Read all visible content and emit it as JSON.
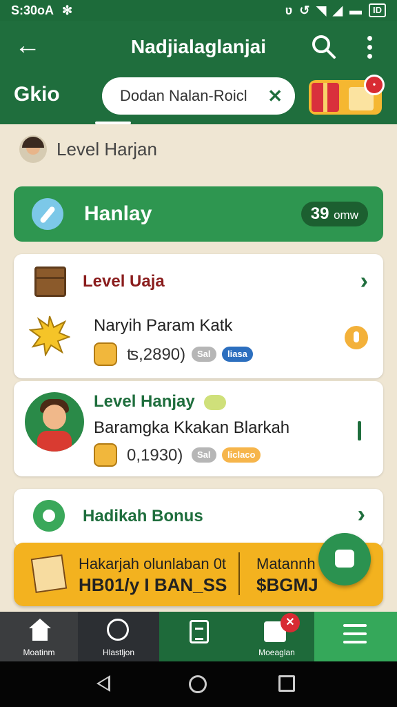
{
  "status_bar": {
    "time": "S:30oA",
    "bluetooth": "✻",
    "battery": "ID"
  },
  "app_bar": {
    "title": "Nadjialaglanjai",
    "tab_label": "Gkio",
    "search_value": "Dodan Nalan-Roicl",
    "clear_symbol": "✕",
    "gift_badge": "•"
  },
  "level_header": {
    "label": "Level Harjan"
  },
  "green_card": {
    "label": "Hanlay",
    "value": "39",
    "unit": "omw"
  },
  "card1": {
    "title": "Level Uaja",
    "subtitle": "Naryih Param Katk",
    "amount": "ʦ,2890)",
    "tag1": "Sal",
    "tag2": "liasa"
  },
  "card2": {
    "title": "Level Hanjay",
    "subtitle": "Baramgka Kkakan Blarkah",
    "amount": "0,1930)",
    "tag1": "Sal",
    "tag2": "liclaco"
  },
  "card3": {
    "title": "Hadikah Bonus"
  },
  "banner": {
    "left_line1": "Hakarjah olunlaban 0t",
    "left_line2": "HB01/y I BAN_SS",
    "right_line1": "Matannh",
    "right_line2": "$BGMJ"
  },
  "bottom_nav": {
    "home": "Moatinm",
    "search": "Hlastljon",
    "messages": "Moeaglan",
    "messages_badge": "✕"
  },
  "colors": {
    "primary_green": "#1f6e3d",
    "accent_green": "#2e9650",
    "banner_yellow": "#f3b21f",
    "badge_red": "#d82b33"
  },
  "icons": [
    "back-arrow-icon",
    "search-icon",
    "more-vert-icon",
    "gift-icon",
    "avatar-icon",
    "feather-icon",
    "box-icon",
    "sun-burst-icon",
    "coin-icon",
    "lock-icon",
    "kid-avatar-icon",
    "bonus-icon",
    "chat-fab-icon",
    "home-icon",
    "search-nav-icon",
    "clipboard-icon",
    "message-icon",
    "menu-icon"
  ]
}
